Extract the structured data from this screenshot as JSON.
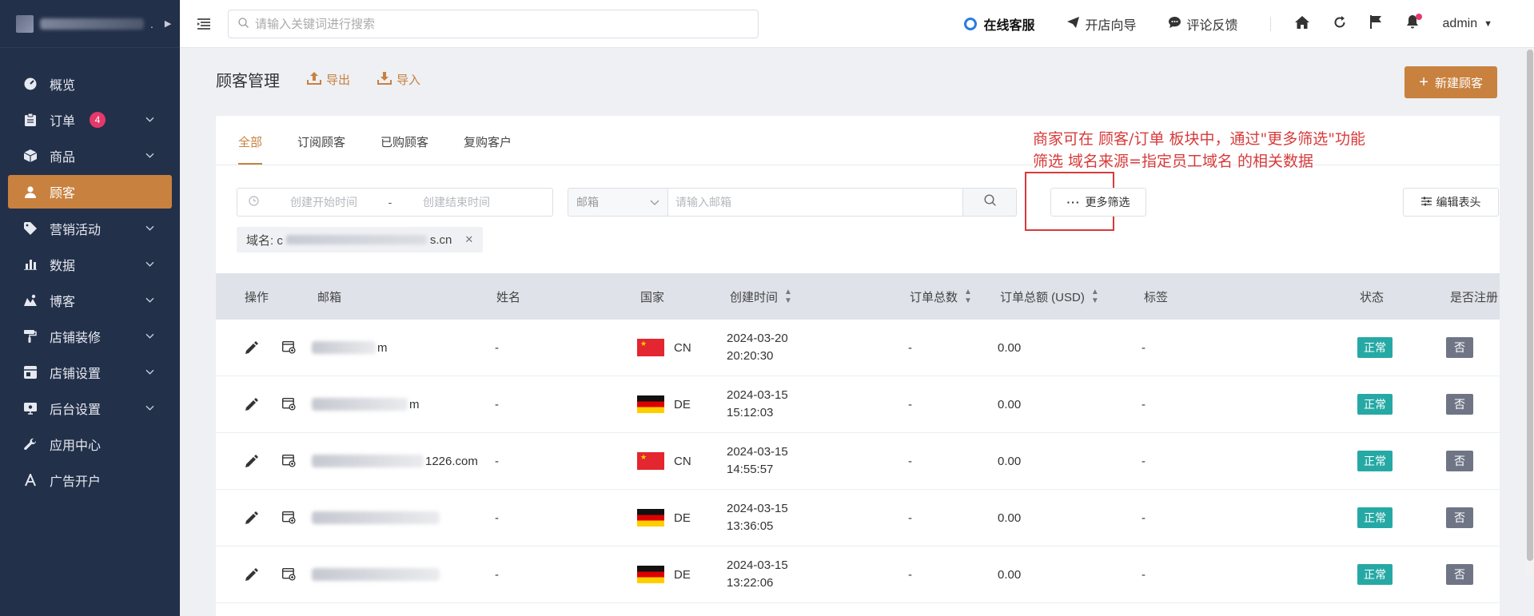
{
  "sidebar": {
    "menu": [
      {
        "label": "概览",
        "icon": "dashboard-icon",
        "badge": "",
        "chevron": false
      },
      {
        "label": "订单",
        "icon": "clipboard-icon",
        "badge": "4",
        "chevron": true
      },
      {
        "label": "商品",
        "icon": "box-icon",
        "badge": "",
        "chevron": true
      },
      {
        "label": "顾客",
        "icon": "user-icon",
        "badge": "",
        "chevron": false,
        "active": true
      },
      {
        "label": "营销活动",
        "icon": "tag-icon",
        "badge": "",
        "chevron": true
      },
      {
        "label": "数据",
        "icon": "bar-chart-icon",
        "badge": "",
        "chevron": true
      },
      {
        "label": "博客",
        "icon": "blog-icon",
        "badge": "",
        "chevron": true
      },
      {
        "label": "店铺装修",
        "icon": "paint-roller-icon",
        "badge": "",
        "chevron": true
      },
      {
        "label": "店铺设置",
        "icon": "store-settings-icon",
        "badge": "",
        "chevron": true
      },
      {
        "label": "后台设置",
        "icon": "admin-settings-icon",
        "badge": "",
        "chevron": true
      },
      {
        "label": "应用中心",
        "icon": "wrench-icon",
        "badge": "",
        "chevron": false
      },
      {
        "label": "广告开户",
        "icon": "ad-icon",
        "badge": "",
        "chevron": false
      }
    ]
  },
  "topbar": {
    "search_placeholder": "请输入关键词进行搜索",
    "online_service": "在线客服",
    "guide": "开店向导",
    "feedback": "评论反馈",
    "user": "admin"
  },
  "page": {
    "title": "顾客管理",
    "export": "导出",
    "import": "导入",
    "new_button": "新建顾客"
  },
  "tabs": [
    "全部",
    "订阅顾客",
    "已购顾客",
    "复购客户"
  ],
  "annotation": {
    "line1": "商家可在 顾客/订单 板块中，通过\"更多筛选\"功能",
    "line2": "筛选 域名来源=指定员工域名 的相关数据"
  },
  "filters": {
    "start_placeholder": "创建开始时间",
    "separator": "-",
    "end_placeholder": "创建结束时间",
    "email_select": "邮箱",
    "email_placeholder": "请输入邮箱",
    "more_filters": "更多筛选",
    "edit_columns": "编辑表头",
    "chip_label": "域名: c",
    "chip_tail": "s.cn"
  },
  "table": {
    "headers": {
      "action": "操作",
      "email": "邮箱",
      "name": "姓名",
      "country": "国家",
      "created": "创建时间",
      "orders": "订单总数",
      "amount": "订单总额 (USD)",
      "tags": "标签",
      "status": "状态",
      "registered": "是否注册"
    },
    "rows": [
      {
        "email_tail": "m",
        "name": "-",
        "flag": "cn",
        "country": "CN",
        "date": "2024-03-20",
        "time": "20:20:30",
        "orders": "-",
        "amount": "0.00",
        "tags": "-",
        "status": "正常",
        "registered": "否"
      },
      {
        "email_tail": "m",
        "name": "-",
        "flag": "de",
        "country": "DE",
        "date": "2024-03-15",
        "time": "15:12:03",
        "orders": "-",
        "amount": "0.00",
        "tags": "-",
        "status": "正常",
        "registered": "否"
      },
      {
        "email_tail": "1226.com",
        "name": "-",
        "flag": "cn",
        "country": "CN",
        "date": "2024-03-15",
        "time": "14:55:57",
        "orders": "-",
        "amount": "0.00",
        "tags": "-",
        "status": "正常",
        "registered": "否"
      },
      {
        "email_tail": "",
        "name": "-",
        "flag": "de",
        "country": "DE",
        "date": "2024-03-15",
        "time": "13:36:05",
        "orders": "-",
        "amount": "0.00",
        "tags": "-",
        "status": "正常",
        "registered": "否"
      },
      {
        "email_tail": "",
        "name": "-",
        "flag": "de",
        "country": "DE",
        "date": "2024-03-15",
        "time": "13:22:06",
        "orders": "-",
        "amount": "0.00",
        "tags": "-",
        "status": "正常",
        "registered": "否"
      }
    ]
  },
  "colors": {
    "sidebar_bg": "#23304a",
    "accent": "#c8813e",
    "status_green": "#26a9a5",
    "annotation_red": "#d83a3a",
    "badge_pink": "#e5396b"
  }
}
